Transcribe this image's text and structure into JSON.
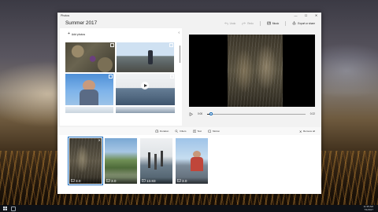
{
  "window": {
    "app_name": "Photos",
    "controls": {
      "minimize": "—",
      "maximize": "☐",
      "close": "✕"
    }
  },
  "toolbar": {
    "project_title": "Summer 2017",
    "undo_label": "Undo",
    "redo_label": "Redo",
    "music_label": "Music",
    "export_label": "Export or share"
  },
  "library": {
    "add_photos_label": "Add photos",
    "add_icon": "plus-icon",
    "collapse_icon": "chevron-left-icon"
  },
  "preview": {
    "current_time": "0:00",
    "total_time": "0:22",
    "progress": 0.04
  },
  "storyboard": {
    "tools": [
      {
        "label": "Duration",
        "icon": "clock-icon"
      },
      {
        "label": "Filters",
        "icon": "filter-icon"
      },
      {
        "label": "Text",
        "icon": "text-icon"
      },
      {
        "label": "Motion",
        "icon": "motion-icon"
      }
    ],
    "remove_all_label": "Remove all",
    "clips": [
      {
        "duration": "3.0",
        "selected": true
      },
      {
        "duration": "3.0",
        "selected": false
      },
      {
        "duration": "13.83",
        "selected": false
      },
      {
        "duration": "3.0",
        "selected": false
      }
    ]
  },
  "taskbar": {
    "time": "11:35 AM",
    "date": "7/1/2017"
  },
  "colors": {
    "accent": "#1f6fbf",
    "window_bg": "#f2f2f2",
    "video_bg": "#000000"
  }
}
